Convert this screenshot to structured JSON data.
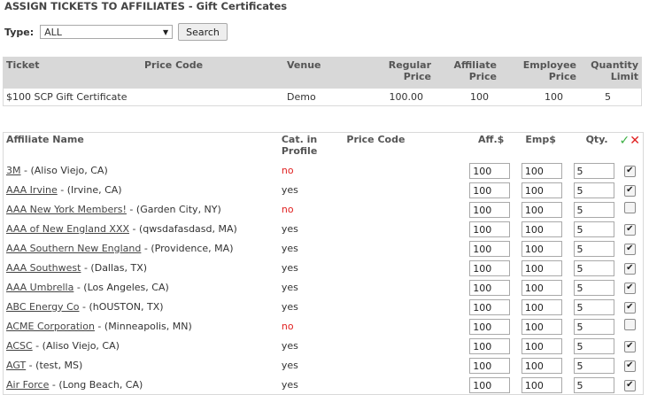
{
  "page": {
    "title": "ASSIGN TICKETS TO AFFILIATES - Gift Certificates"
  },
  "filter": {
    "label": "Type:",
    "selected": "ALL",
    "search_label": "Search"
  },
  "tickets_table": {
    "headers": {
      "ticket": "Ticket",
      "price_code": "Price Code",
      "venue": "Venue",
      "regular_price": "Regular Price",
      "affiliate_price": "Affiliate Price",
      "employee_price": "Employee Price",
      "quantity_limit": "Quantity Limit"
    },
    "rows": [
      {
        "ticket": "$100 SCP Gift Certificate",
        "price_code": "",
        "venue": "Demo",
        "regular_price": "100.00",
        "affiliate_price": "100",
        "employee_price": "100",
        "quantity_limit": "5"
      }
    ]
  },
  "affiliates_table": {
    "headers": {
      "affiliate_name": "Affiliate Name",
      "cat_in_profile": "Cat. in Profile",
      "price_code": "Price Code",
      "aff_price": "Aff.$",
      "emp_price": "Emp$",
      "qty": "Qty.",
      "check_all": "✓",
      "uncheck_all": "✕"
    },
    "rows": [
      {
        "name": "3M",
        "location": " - (Aliso Viejo, CA)",
        "cat": "no",
        "aff": "100",
        "emp": "100",
        "qty": "5",
        "checked": true
      },
      {
        "name": "AAA Irvine",
        "location": " - (Irvine, CA)",
        "cat": "yes",
        "aff": "100",
        "emp": "100",
        "qty": "5",
        "checked": true
      },
      {
        "name": "AAA New York Members!",
        "location": " - (Garden City, NY)",
        "cat": "no",
        "aff": "100",
        "emp": "100",
        "qty": "5",
        "checked": false
      },
      {
        "name": "AAA of New England XXX",
        "location": " - (qwsdafasdasd, MA)",
        "cat": "yes",
        "aff": "100",
        "emp": "100",
        "qty": "5",
        "checked": true
      },
      {
        "name": "AAA Southern New England",
        "location": " - (Providence, MA)",
        "cat": "yes",
        "aff": "100",
        "emp": "100",
        "qty": "5",
        "checked": true
      },
      {
        "name": "AAA Southwest",
        "location": " - (Dallas, TX)",
        "cat": "yes",
        "aff": "100",
        "emp": "100",
        "qty": "5",
        "checked": true
      },
      {
        "name": "AAA Umbrella",
        "location": " - (Los Angeles, CA)",
        "cat": "yes",
        "aff": "100",
        "emp": "100",
        "qty": "5",
        "checked": true
      },
      {
        "name": "ABC Energy Co",
        "location": " - (hOUSTON, TX)",
        "cat": "yes",
        "aff": "100",
        "emp": "100",
        "qty": "5",
        "checked": true
      },
      {
        "name": "ACME Corporation",
        "location": " - (Minneapolis, MN)",
        "cat": "no",
        "aff": "100",
        "emp": "100",
        "qty": "5",
        "checked": false
      },
      {
        "name": "ACSC",
        "location": " - (Aliso Viejo, CA)",
        "cat": "yes",
        "aff": "100",
        "emp": "100",
        "qty": "5",
        "checked": true
      },
      {
        "name": "AGT",
        "location": " - (test, MS)",
        "cat": "yes",
        "aff": "100",
        "emp": "100",
        "qty": "5",
        "checked": true
      },
      {
        "name": "Air Force",
        "location": " - (Long Beach, CA)",
        "cat": "yes",
        "aff": "100",
        "emp": "100",
        "qty": "5",
        "checked": true
      }
    ]
  },
  "colors": {
    "no": "#e02020",
    "check": "#3cb043",
    "header_bg": "#d8d8d8"
  }
}
